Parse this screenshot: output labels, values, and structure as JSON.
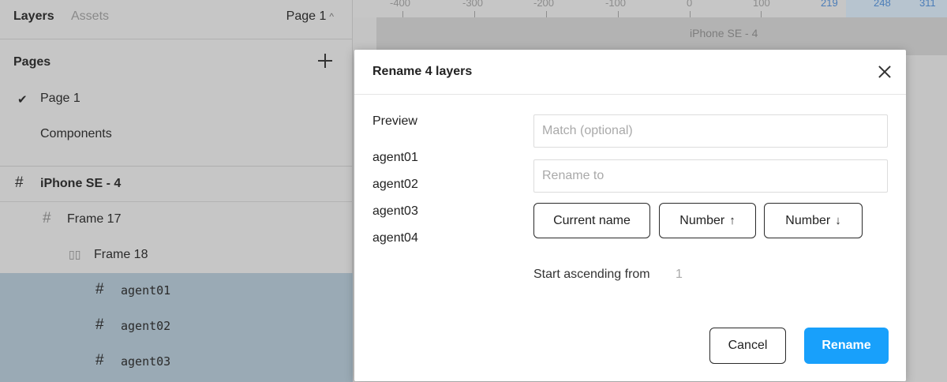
{
  "sidebar": {
    "tabs": {
      "layers": "Layers",
      "assets": "Assets"
    },
    "current_page": "Page 1",
    "pages_title": "Pages",
    "pages": [
      "Page 1",
      "Components"
    ],
    "layers": [
      {
        "label": "iPhone SE - 4",
        "icon": "frame-icon"
      },
      {
        "label": "Frame 17",
        "icon": "frame-icon"
      },
      {
        "label": "Frame 18",
        "icon": "auto-layout-icon"
      },
      {
        "label": "agent01",
        "icon": "frame-icon"
      },
      {
        "label": "agent02",
        "icon": "frame-icon"
      },
      {
        "label": "agent03",
        "icon": "frame-icon"
      }
    ]
  },
  "canvas": {
    "ruler_ticks": [
      "-400",
      "-300",
      "-200",
      "-100",
      "0",
      "100",
      "219",
      "248",
      "311"
    ],
    "frame_label": "iPhone SE - 4"
  },
  "dialog": {
    "title": "Rename 4 layers",
    "preview_title": "Preview",
    "preview_items": [
      "agent01",
      "agent02",
      "agent03",
      "agent04"
    ],
    "match_placeholder": "Match (optional)",
    "rename_placeholder": "Rename to",
    "buttons": {
      "current_name": "Current name",
      "number_asc": "Number",
      "number_desc": "Number",
      "cancel": "Cancel",
      "rename": "Rename"
    },
    "start_label": "Start ascending from",
    "start_value": "1"
  },
  "colors": {
    "accent": "#18a0fb",
    "selection": "#9aaab5"
  }
}
